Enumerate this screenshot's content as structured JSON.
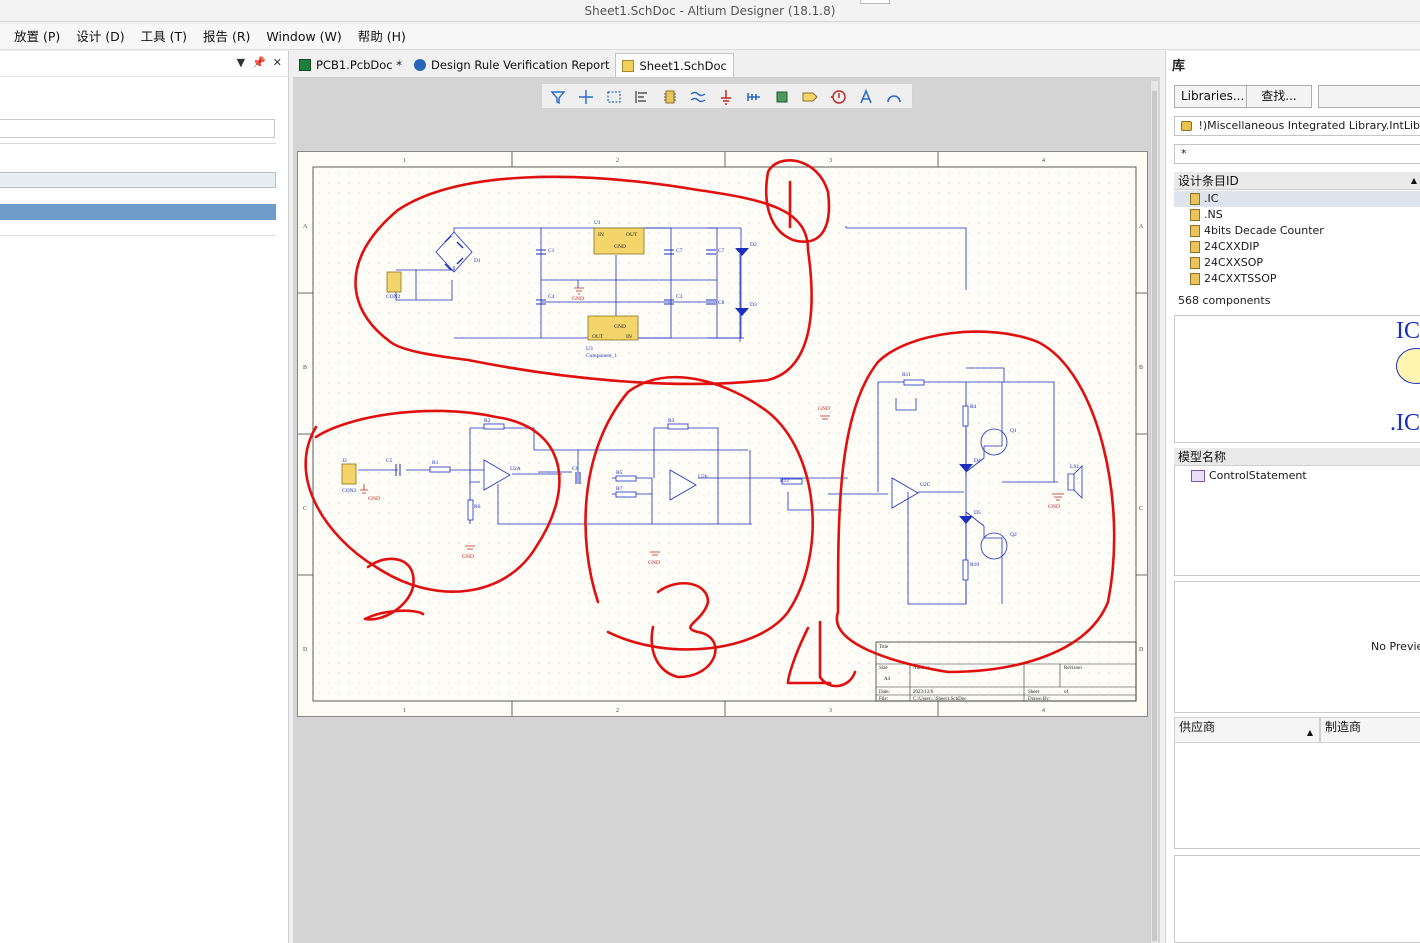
{
  "window": {
    "title": "Sheet1.SchDoc - Altium Designer (18.1.8)"
  },
  "menu": [
    {
      "label": "放置 (P)"
    },
    {
      "label": "设计 (D)"
    },
    {
      "label": "工具 (T)"
    },
    {
      "label": "报告 (R)"
    },
    {
      "label": "Window (W)"
    },
    {
      "label": "帮助 (H)"
    }
  ],
  "tabs": [
    {
      "label": "PCB1.PcbDoc *",
      "icon": "pcb-doc-icon"
    },
    {
      "label": "Design Rule Verification Report",
      "icon": "report-icon"
    },
    {
      "label": "Sheet1.SchDoc",
      "icon": "schematic-doc-icon"
    }
  ],
  "schematic": {
    "col_labels": [
      "1",
      "2",
      "3",
      "4"
    ],
    "row_labels": [
      "A",
      "B",
      "C",
      "D"
    ],
    "annotations": [
      "1",
      "2",
      "3",
      "4"
    ],
    "designators": {
      "u1": "U1",
      "u3": "U3",
      "u3_comment": "Component_1",
      "in": "IN",
      "out": "OUT",
      "gnd": "GND",
      "d1": "D1",
      "d2": "D2",
      "d3": "D3",
      "d4": "D4",
      "d5": "D5",
      "c1": "C1",
      "c3": "C3",
      "c4": "C4",
      "c5": "C5",
      "c6": "C6",
      "c7": "C7",
      "c8": "C8",
      "con2a": "CON2",
      "con2b": "CON2",
      "j2": "J2",
      "r1": "R1",
      "r2": "R2",
      "r3": "R3",
      "r4": "R4",
      "r5": "R5",
      "r6": "R6",
      "r7": "R7",
      "r10": "R10",
      "r11": "R11",
      "r12": "R12",
      "u2a": "U2A",
      "u2b": "U2b",
      "u2c": "U2C",
      "q1": "Q1",
      "q2": "Q2",
      "ls1": "LS1"
    },
    "title_block": {
      "title": "Title",
      "size_label": "Size",
      "size_value": "A4",
      "number_label": "Number",
      "revision_label": "Revision",
      "date_label": "Date:",
      "date_value": "2023/12/6",
      "file_label": "File:",
      "file_value": "C:\\Users\\..\\Sheet1.SchDoc",
      "sheet_label": "Sheet",
      "of_label": "of",
      "drawn_label": "Drawn By:"
    }
  },
  "library_panel": {
    "title": "库",
    "libraries_button": "Libraries...",
    "search_button": "查找...",
    "library_name": "!)Miscellaneous Integrated Library.IntLib",
    "filter": "*",
    "list_header": "设计条目ID",
    "components": [
      ".IC",
      ".NS",
      "4bits Decade Counter",
      "24CXXDIP",
      "24CXXSOP",
      "24CXXTSSOP"
    ],
    "count": "568 components",
    "preview_symbol_top": "IC",
    "preview_symbol_bottom": ".IC",
    "model_header": "模型名称",
    "models": [
      "ControlStatement"
    ],
    "no_preview": "No Preview",
    "supplier_header": "供应商",
    "manufacturer_header": "制造商"
  },
  "colors": {
    "annotation_red": "#e01010",
    "wire_blue": "#1a2fbf",
    "component_yellow": "#f3d56b",
    "selection_blue": "#6e9cc9"
  }
}
